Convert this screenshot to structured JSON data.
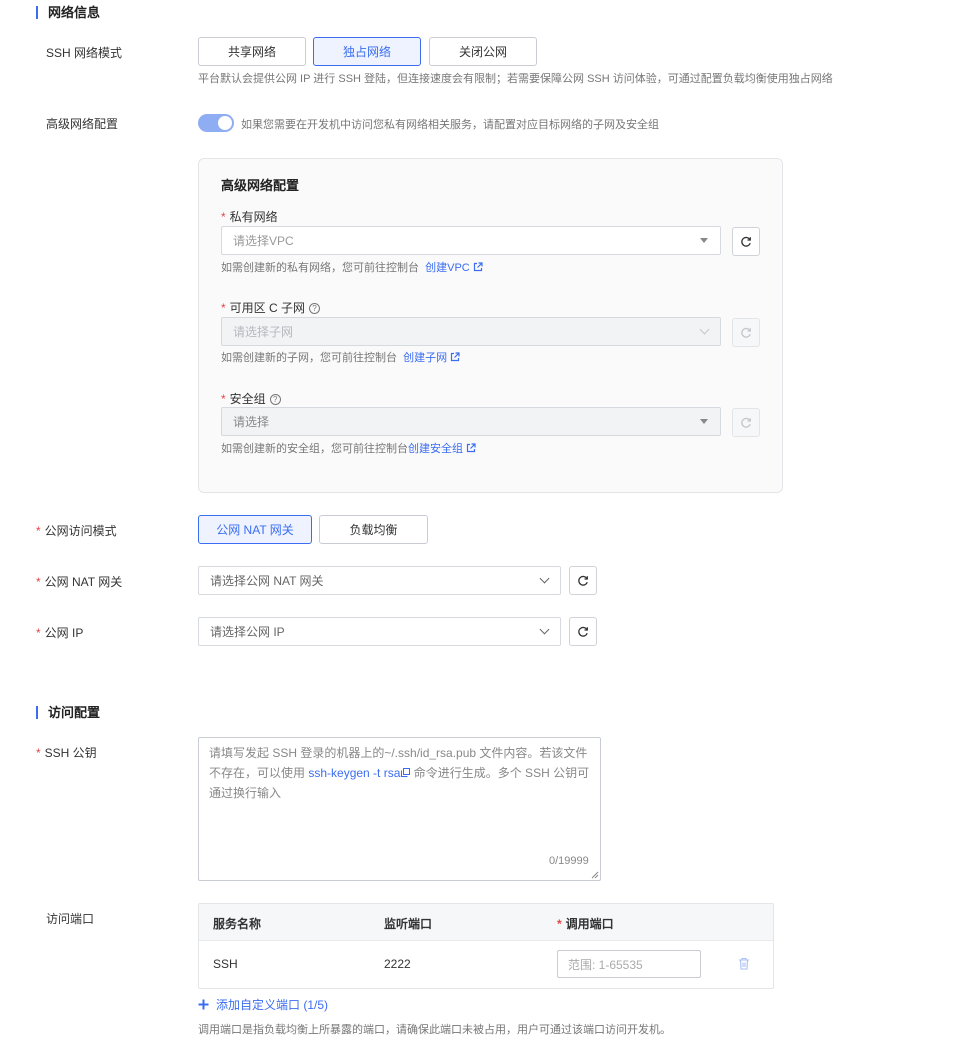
{
  "network": {
    "section_title": "网络信息",
    "ssh_mode_label": "SSH 网络模式",
    "ssh_mode_options": [
      "共享网络",
      "独占网络",
      "关闭公网"
    ],
    "ssh_mode_selected": "独占网络",
    "ssh_mode_hint": "平台默认会提供公网 IP 进行 SSH 登陆，但连接速度会有限制；若需要保障公网 SSH 访问体验，可通过配置负载均衡使用独占网络",
    "advanced_label": "高级网络配置",
    "advanced_toggle_on": true,
    "advanced_hint": "如果您需要在开发机中访问您私有网络相关服务，请配置对应目标网络的子网及安全组",
    "advanced_panel": {
      "title": "高级网络配置",
      "vpc": {
        "label": "私有网络",
        "placeholder": "请选择VPC",
        "hint": "如需创建新的私有网络，您可前往控制台",
        "link": "创建VPC"
      },
      "subnet": {
        "label": "可用区 C 子网",
        "placeholder": "请选择子网",
        "hint": "如需创建新的子网，您可前往控制台",
        "link": "创建子网"
      },
      "security_group": {
        "label": "安全组",
        "placeholder": "请选择",
        "hint": "如需创建新的安全组，您可前往控制台",
        "link": "创建安全组"
      }
    },
    "public_mode_label": "公网访问模式",
    "public_mode_options": [
      "公网 NAT 网关",
      "负载均衡"
    ],
    "public_mode_selected": "公网 NAT 网关",
    "nat_label": "公网 NAT 网关",
    "nat_placeholder": "请选择公网 NAT 网关",
    "ip_label": "公网 IP",
    "ip_placeholder": "请选择公网 IP"
  },
  "access": {
    "section_title": "访问配置",
    "ssh_key_label": "SSH 公钥",
    "ssh_key_placeholder_1": "请填写发起 SSH 登录的机器上的~/.ssh/id_rsa.pub 文件内容。若该文件",
    "ssh_key_placeholder_2a": "不存在，可以使用 ",
    "ssh_key_placeholder_cmd": "ssh-keygen -t rsa",
    "ssh_key_placeholder_2b": " 命令进行生成。多个 SSH 公钥可",
    "ssh_key_placeholder_3": "通过换行输入",
    "ssh_key_counter": "0/19999",
    "port_label": "访问端口",
    "table_headers": [
      "服务名称",
      "监听端口",
      "调用端口"
    ],
    "rows": [
      {
        "service": "SSH",
        "listen_port": "2222",
        "call_port_placeholder": "范围: 1-65535"
      }
    ],
    "add_port": "添加自定义端口 (1/5)",
    "port_hint": "调用端口是指负载均衡上所暴露的端口，请确保此端口未被占用，用户可通过该端口访问开发机。"
  },
  "colors": {
    "accent": "#3a6df0",
    "required": "#e54545"
  }
}
